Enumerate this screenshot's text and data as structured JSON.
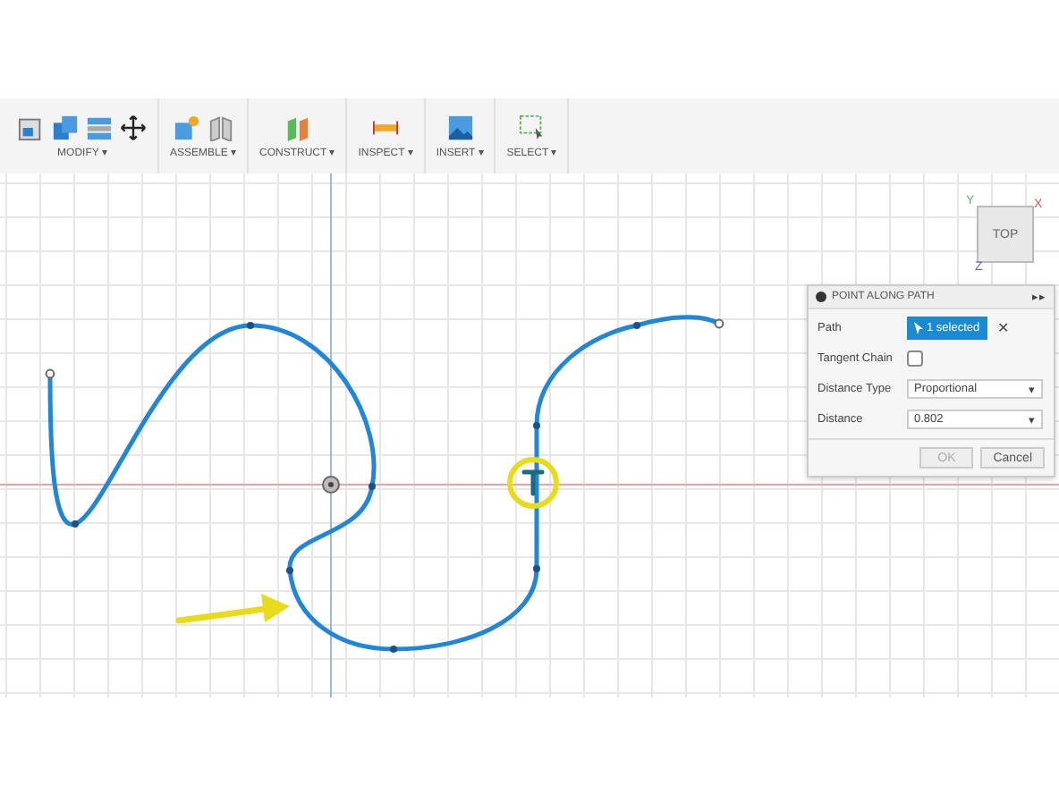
{
  "toolbar": {
    "groups": [
      {
        "label": "MODIFY ▾"
      },
      {
        "label": "ASSEMBLE ▾"
      },
      {
        "label": "CONSTRUCT ▾"
      },
      {
        "label": "INSPECT ▾"
      },
      {
        "label": "INSERT ▾"
      },
      {
        "label": "SELECT ▾"
      }
    ]
  },
  "viewcube": {
    "face": "TOP",
    "axes": [
      "X",
      "Y",
      "Z"
    ]
  },
  "dialog": {
    "title": "POINT ALONG PATH",
    "expand": "▸▸",
    "rows": [
      {
        "kind": "selection",
        "label": "Path",
        "value": "1 selected",
        "clear": "✕"
      },
      {
        "kind": "checkbox",
        "label": "Tangent Chain",
        "checked": false
      },
      {
        "kind": "dropdown",
        "label": "Distance Type",
        "value": "Proportional",
        "caret": "▾"
      },
      {
        "kind": "input",
        "label": "Distance",
        "value": "0.802",
        "caret": "▾"
      }
    ],
    "buttons": [
      {
        "label": "OK",
        "disabled": true
      },
      {
        "label": "Cancel",
        "disabled": false
      }
    ]
  }
}
